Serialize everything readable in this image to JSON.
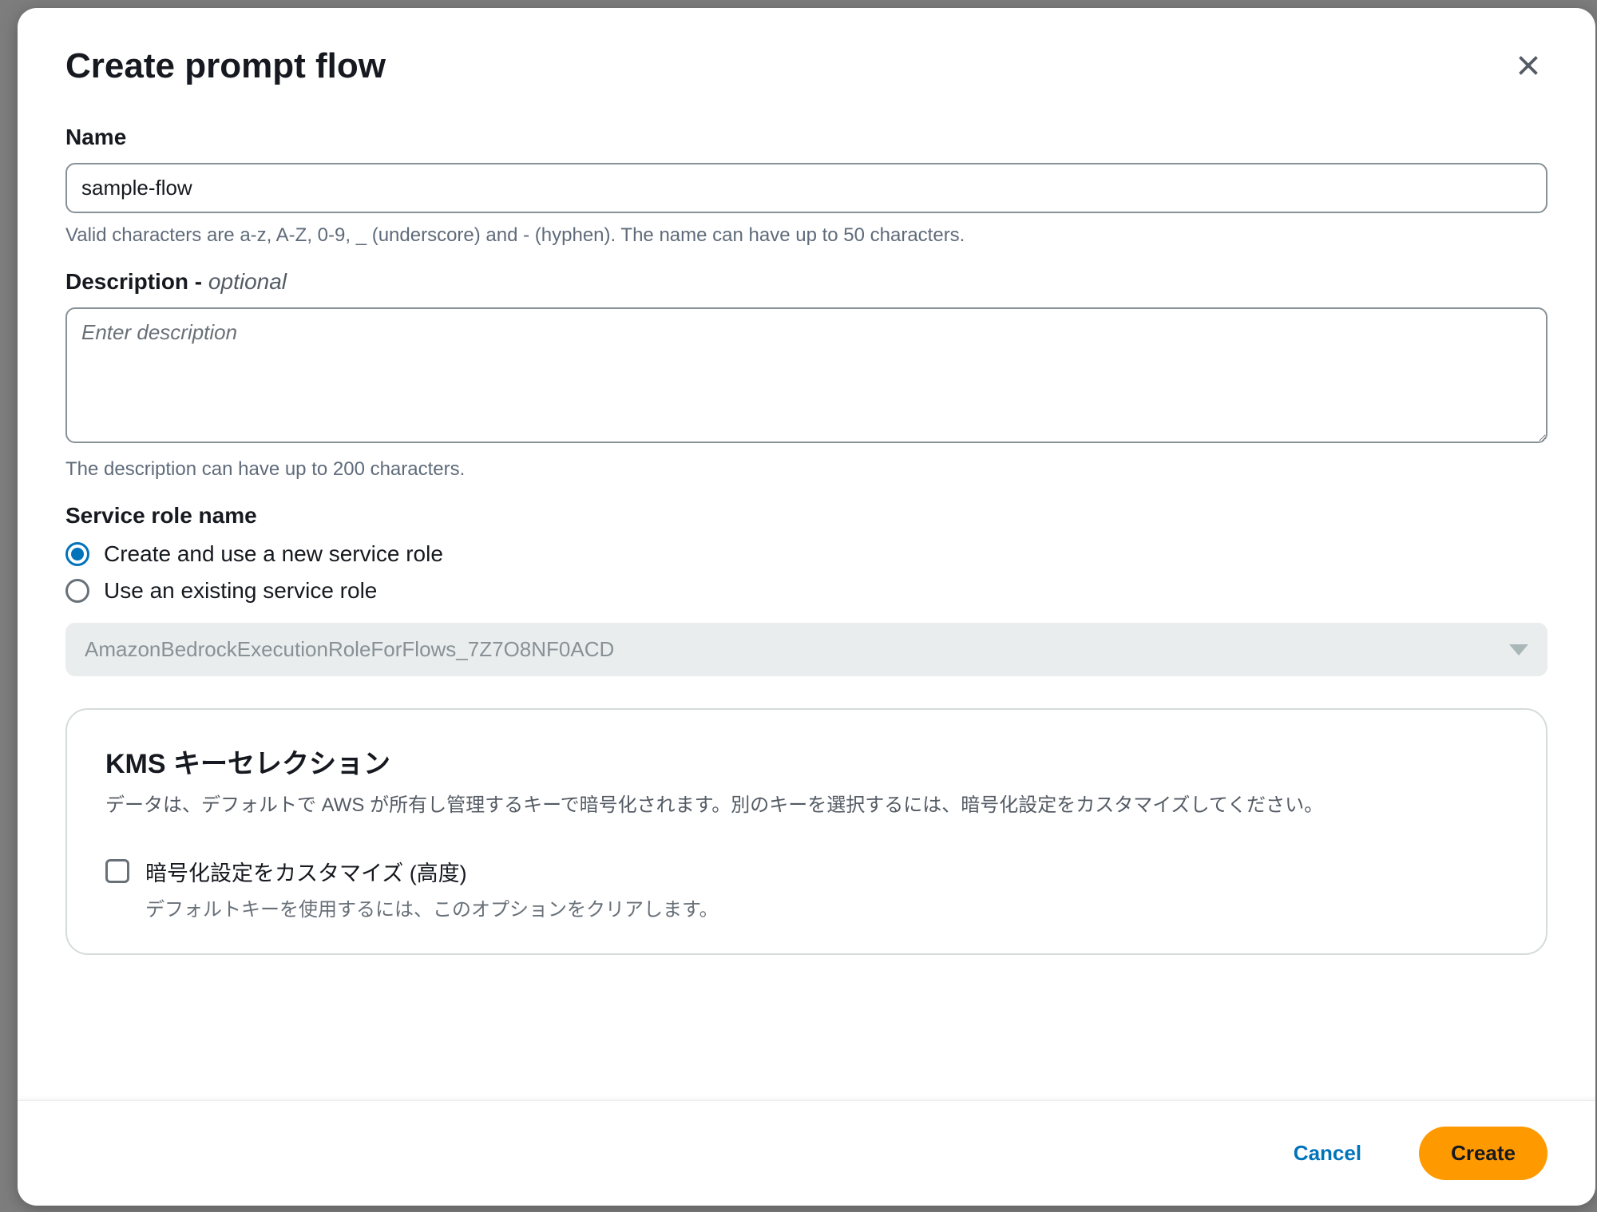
{
  "modal": {
    "title": "Create prompt flow",
    "name": {
      "label": "Name",
      "value": "sample-flow",
      "hint": "Valid characters are a-z, A-Z, 0-9, _ (underscore) and - (hyphen). The name can have up to 50 characters."
    },
    "description": {
      "label": "Description - ",
      "optional_tag": "optional",
      "placeholder": "Enter description",
      "value": "",
      "hint": "The description can have up to 200 characters."
    },
    "service_role": {
      "label": "Service role name",
      "options": [
        {
          "label": "Create and use a new service role",
          "selected": true
        },
        {
          "label": "Use an existing service role",
          "selected": false
        }
      ],
      "select_value": "AmazonBedrockExecutionRoleForFlows_7Z7O8NF0ACD"
    },
    "kms": {
      "title": "KMS キーセレクション",
      "desc": "データは、デフォルトで AWS が所有し管理するキーで暗号化されます。別のキーを選択するには、暗号化設定をカスタマイズしてください。",
      "checkbox_label": "暗号化設定をカスタマイズ (高度)",
      "checkbox_sub": "デフォルトキーを使用するには、このオプションをクリアします。",
      "checked": false
    },
    "footer": {
      "cancel": "Cancel",
      "create": "Create"
    }
  }
}
